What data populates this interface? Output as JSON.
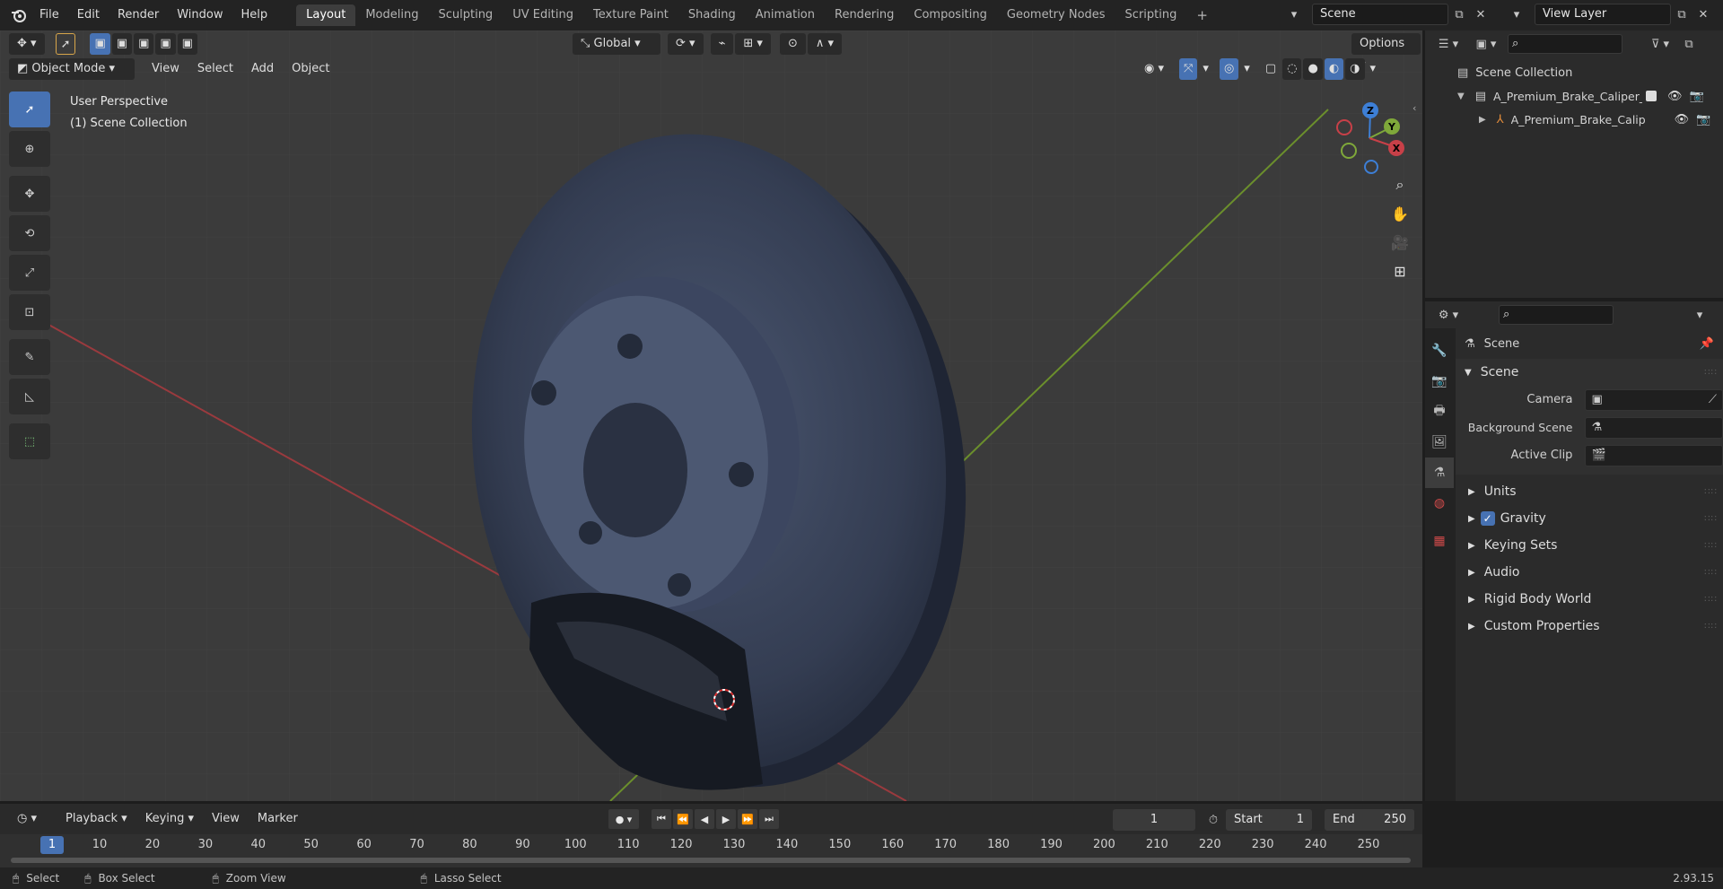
{
  "topbar": {
    "menus": [
      "File",
      "Edit",
      "Render",
      "Window",
      "Help"
    ],
    "workspaces": [
      {
        "label": "Layout",
        "active": true
      },
      {
        "label": "Modeling"
      },
      {
        "label": "Sculpting"
      },
      {
        "label": "UV Editing"
      },
      {
        "label": "Texture Paint"
      },
      {
        "label": "Shading"
      },
      {
        "label": "Animation"
      },
      {
        "label": "Rendering"
      },
      {
        "label": "Compositing"
      },
      {
        "label": "Geometry Nodes"
      },
      {
        "label": "Scripting"
      }
    ],
    "add_tab": "+",
    "scene_name": "Scene",
    "view_layer": "View Layer"
  },
  "viewport": {
    "transform_orientation": "Global",
    "options_label": "Options",
    "mode": "Object Mode",
    "menus": [
      "View",
      "Select",
      "Add",
      "Object"
    ],
    "overlay_line1": "User Perspective",
    "overlay_line2": "(1) Scene Collection",
    "gizmo": {
      "x": "X",
      "y": "Y",
      "z": "Z"
    }
  },
  "outliner": {
    "root": "Scene Collection",
    "items": [
      {
        "label": "A_Premium_Brake_Caliper_Pa",
        "level": 1
      },
      {
        "label": "A_Premium_Brake_Calip",
        "level": 2
      }
    ]
  },
  "properties": {
    "context_title": "Scene",
    "section": "Scene",
    "rows": [
      {
        "label": "Camera"
      },
      {
        "label": "Background Scene"
      },
      {
        "label": "Active Clip"
      }
    ],
    "panels": [
      {
        "label": "Units",
        "checkbox": false
      },
      {
        "label": "Gravity",
        "checkbox": true
      },
      {
        "label": "Keying Sets",
        "checkbox": false
      },
      {
        "label": "Audio",
        "checkbox": false
      },
      {
        "label": "Rigid Body World",
        "checkbox": false
      },
      {
        "label": "Custom Properties",
        "checkbox": false
      }
    ]
  },
  "timeline": {
    "menus": [
      "Playback",
      "Keying",
      "View",
      "Marker"
    ],
    "current_frame": "1",
    "start_label": "Start",
    "start_value": "1",
    "end_label": "End",
    "end_value": "250",
    "ruler": [
      "1",
      "10",
      "20",
      "30",
      "40",
      "50",
      "60",
      "70",
      "80",
      "90",
      "100",
      "110",
      "120",
      "130",
      "140",
      "150",
      "160",
      "170",
      "180",
      "190",
      "200",
      "210",
      "220",
      "230",
      "240",
      "250"
    ]
  },
  "statusbar": {
    "select": "Select",
    "box_select": "Box Select",
    "zoom_view": "Zoom View",
    "lasso_select": "Lasso Select",
    "version": "2.93.15"
  },
  "colors": {
    "accent": "#4772b3",
    "x_axis": "#c84048",
    "y_axis": "#7fa83a",
    "z_axis": "#3d7fd6"
  }
}
